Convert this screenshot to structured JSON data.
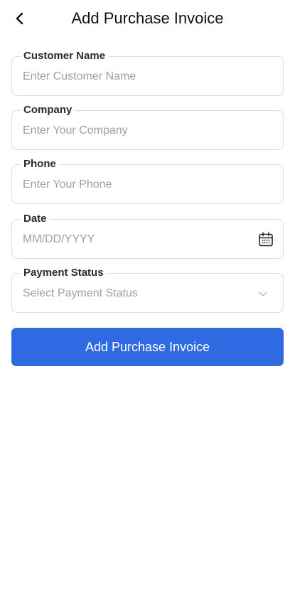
{
  "header": {
    "title": "Add Purchase Invoice",
    "back_icon": "chevron-left-icon"
  },
  "form": {
    "customer_name": {
      "label": "Customer Name",
      "placeholder": "Enter Customer Name",
      "value": ""
    },
    "company": {
      "label": "Company",
      "placeholder": "Enter Your Company",
      "value": ""
    },
    "phone": {
      "label": "Phone",
      "placeholder": "Enter Your Phone",
      "value": ""
    },
    "date": {
      "label": "Date",
      "placeholder": "MM/DD/YYYY",
      "value": "",
      "icon": "calendar-icon"
    },
    "payment_status": {
      "label": "Payment Status",
      "placeholder": "Select Payment Status",
      "icon": "chevron-down-icon"
    }
  },
  "submit_label": "Add Purchase Invoice",
  "colors": {
    "primary": "#2f6ae3",
    "border": "#dcdcdc",
    "placeholder": "#a0a0a0"
  }
}
